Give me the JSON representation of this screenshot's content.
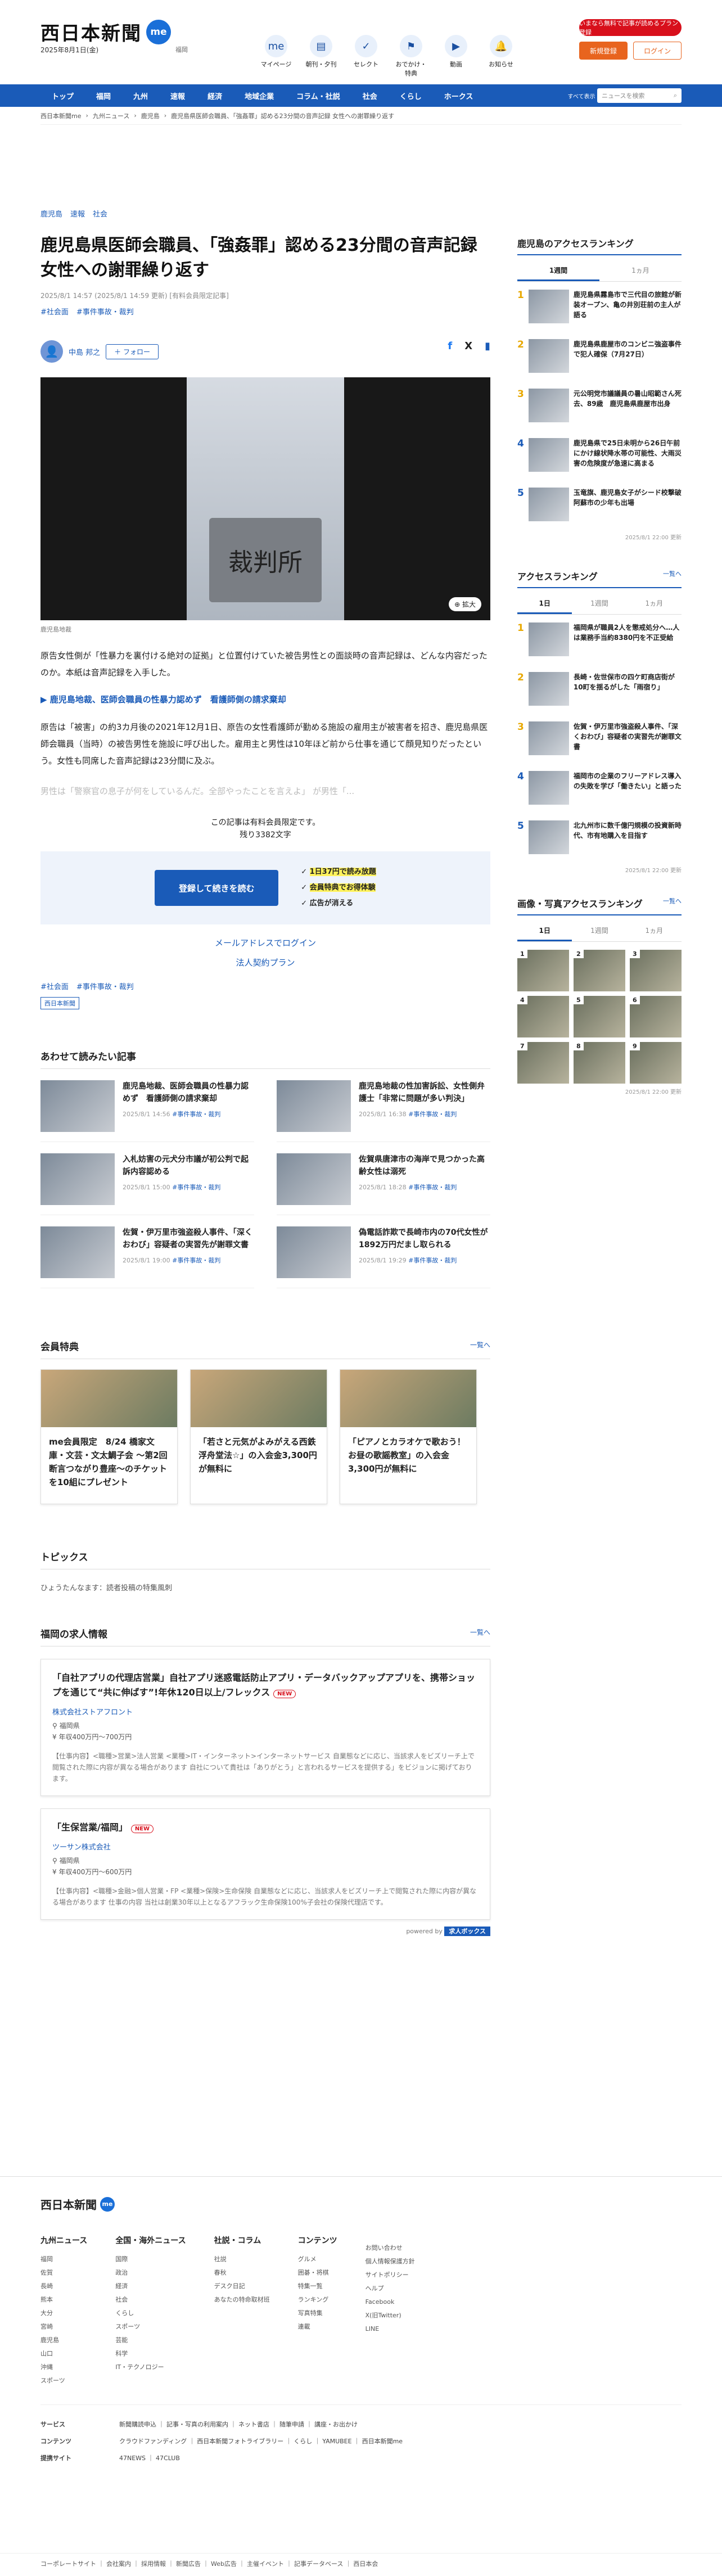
{
  "header": {
    "logo": "西日本新聞",
    "logo_me": "me",
    "date": "2025年8月1日(金)",
    "kyoku": "福岡",
    "icons": [
      {
        "label": "マイページ",
        "g": "me"
      },
      {
        "label": "朝刊・夕刊",
        "g": "▤"
      },
      {
        "label": "セレクト",
        "g": "✓"
      },
      {
        "label": "おでかけ・特典",
        "g": "⚑"
      },
      {
        "label": "動画",
        "g": "▶"
      },
      {
        "label": "お知らせ",
        "g": "🔔"
      }
    ],
    "register": "いまなら無料で記事が読めるプラン登録",
    "signup": "新規登録",
    "login": "ログイン"
  },
  "nav": {
    "items": [
      "トップ",
      "福岡",
      "九州",
      "速報",
      "経済",
      "地域企業",
      "コラム・社説",
      "社会",
      "くらし",
      "ホークス"
    ],
    "menu": "すべて表示",
    "search_placeholder": "ニュースを検索"
  },
  "breadcrumb": [
    "西日本新聞me",
    "九州ニュース",
    "鹿児島",
    "鹿児島県医師会職員、「強姦罪」認める23分間の音声記録 女性への謝罪繰り返す"
  ],
  "article": {
    "tags": [
      "鹿児島",
      "速報",
      "社会"
    ],
    "title": "鹿児島県医師会職員、「強姦罪」認める23分間の音声記録　女性への謝罪繰り返す",
    "meta": "2025/8/1 14:57 (2025/8/1 14:59 更新) [有料会員限定記事]",
    "hashtags": [
      "#社会面",
      "#事件事故・裁判"
    ],
    "author": "中島 邦之",
    "follow": "＋ フォロー",
    "photo_sign": "裁判所",
    "expand": "拡大",
    "caption": "鹿児島地裁",
    "p1": "原告女性側が「性暴力を裏付ける絶対の証拠」と位置付けていた被告男性との面談時の音声記録は、どんな内容だったのか。本紙は音声記録を入手した。",
    "link": "▶ 鹿児島地裁、医師会職員の性暴力認めず　看護師側の請求棄却",
    "p2": "原告は「被害」の約3カ月後の2021年12月1日、原告の女性看護師が勤める施設の雇用主が被害者を招き、鹿児島県医師会職員（当時）の被告男性を施設に呼び出した。雇用主と男性は10年ほど前から仕事を通じて顔見知りだったという。女性も同席した音声記録は23分間に及ぶ。",
    "p3": "男性は「警察官の息子が何をしているんだ。全部やったことを言えよ」 が男性「...",
    "paywall_line1": "この記事は有料会員限定です。",
    "paywall_line2": "残り3382文字",
    "cta": "登録して続きを読む",
    "benefits": [
      "1日37円で読み放題",
      "会員特典でお得体験",
      "広告が消える"
    ],
    "mail_login": "メールアドレスでログイン",
    "corp": "法人契約プラン",
    "bottom_tags": [
      "#社会面",
      "#事件事故・裁判"
    ],
    "source": "西日本新聞"
  },
  "related": {
    "title": "あわせて読みたい記事",
    "items": [
      {
        "t": "鹿児島地裁、医師会職員の性暴力認めず　看護師側の請求棄却",
        "d": "2025/8/1 14:56",
        "tag": "#事件事故・裁判"
      },
      {
        "t": "鹿児島地裁の性加害訴訟、女性側弁護士「非常に問題が多い判決」",
        "d": "2025/8/1 16:38",
        "tag": "#事件事故・裁判"
      },
      {
        "t": "入札妨害の元犬分市議が初公判で起訴内容認める",
        "d": "2025/8/1 15:00",
        "tag": "#事件事故・裁判"
      },
      {
        "t": "佐賀県唐津市の海岸で見つかった高齢女性は溺死",
        "d": "2025/8/1 18:28",
        "tag": "#事件事故・裁判"
      },
      {
        "t": "佐賀・伊万里市強盗殺人事件、「深くおわび」容疑者の実習先が謝罪文書",
        "d": "2025/8/1 19:00",
        "tag": "#事件事故・裁判"
      },
      {
        "t": "偽電話詐欺で長崎市内の70代女性が1892万円だまし取られる",
        "d": "2025/8/1 19:29",
        "tag": "#事件事故・裁判"
      }
    ]
  },
  "perks": {
    "title": "会員特典",
    "more": "一覧へ",
    "items": [
      "me会員限定　8/24 橋家文庫・文芸・文太鯛子会 〜第2回断言つながり豊座〜のチケットを10組にプレゼント",
      "「若さと元気がよみがえる西鉄浮舟堂法☆」の入会金3,300円が無料に",
      "「ピアノとカラオケで歌おう！　お昼の歌謡教室」の入会金3,300円が無料に"
    ]
  },
  "topics": {
    "title": "トピックス",
    "item": "ひょうたんなます：読者投稿の特集風刺"
  },
  "jobs": {
    "title": "福岡の求人情報",
    "more": "一覧へ",
    "items": [
      {
        "t": "「自社アプリの代理店営業」自社アプリ迷惑電話防止アプリ・データバックアップアプリを、携帯ショップを通じて“共に伸ばす”!年休120日以上/フレックス",
        "co": "株式会社ストアフロント",
        "loc": "福岡県",
        "sal": "年収400万円〜700万円",
        "d": "【仕事内容】<職種>営業>法人営業 <業種>IT・インターネット>インターネットサービス 自業態などに応じ、当該求人をビズリーチ上で閲覧された際に内容が異なる場合があります 自社について貴社は「ありがとう」と言われるサービスを提供する」をビジョンに掲げております。"
      },
      {
        "t": "「生保営業/福岡」",
        "co": "ツーサン株式会社",
        "loc": "福岡県",
        "sal": "年収400万円〜600万円",
        "d": "【仕事内容】<職種>金融>個人営業・FP <業種>保険>生命保険 自業態などに応じ、当該求人をビズリーチ上で閲覧された際に内容が異なる場合があります 仕事の内容 当社は創業30年以上となるアフラック生命保険100%子会社の保険代理店です。"
      }
    ],
    "powered": "powered by",
    "box": "求人ボックス"
  },
  "sidebar": {
    "rank1": {
      "title": "鹿児島のアクセスランキング",
      "tabs": [
        "1週間",
        "1ヵ月"
      ],
      "items": [
        "鹿児島県霧島市で三代目の旅館が新装オープン、亀の井別荘前の主人が語る",
        "鹿児島県鹿屋市のコンビニ強盗事件で犯人確保（7月27日）",
        "元公明党市議議員の暑山昭範さん死去、89歳　鹿児島県鹿屋市出身",
        "鹿児島県で25日未明から26日午前にかけ線状降水帯の可能性、大雨災害の危険度が急速に高まる",
        "玉竜旗、鹿児島女子がシード校撃破　阿蘇市の少年も出場"
      ],
      "updated": "2025/8/1 22:00 更新"
    },
    "rank2": {
      "title": "アクセスランキング",
      "more": "一覧へ",
      "tabs": [
        "1日",
        "1週間",
        "1ヵ月"
      ],
      "items": [
        "福岡県が職員2人を懲戒処分へ…人は業務手当約8380円を不正受給",
        "長崎・佐世保市の四ケ町商店街が10町を揺るがした「雨宿り」",
        "佐賀・伊万里市強盗殺人事件、「深くおわび」容疑者の実習先が謝罪文書",
        "福岡市の企業のフリーアドレス導入の失敗を学び「働きたい」と語った",
        "北九州市に数千億円規模の投資新時代、市有地購入を目指す"
      ],
      "updated": "2025/8/1 22:00 更新"
    },
    "photos": {
      "title": "画像・写真アクセスランキング",
      "more": "一覧へ",
      "tabs": [
        "1日",
        "1週間",
        "1ヵ月"
      ],
      "updated": "2025/8/1 22:00 更新"
    }
  },
  "footer": {
    "logo": "西日本新聞",
    "cols": [
      {
        "h": "九州ニュース",
        "items": [
          "福岡",
          "佐賀",
          "長崎",
          "熊本",
          "大分",
          "宮崎",
          "鹿児島",
          "山口",
          "沖縄",
          "スポーツ"
        ]
      },
      {
        "h": "全国・海外ニュース",
        "items": [
          "国際",
          "政治",
          "経済",
          "社会",
          "くらし",
          "スポーツ",
          "芸能",
          "科学",
          "IT・テクノロジー"
        ]
      },
      {
        "h": "社説・コラム",
        "items": [
          "社説",
          "春秋",
          "デスク日記",
          "あなたの特命取材班"
        ]
      },
      {
        "h": "コンテンツ",
        "items": [
          "グルメ",
          "囲碁・将棋",
          "特集一覧",
          "ランキング",
          "写真特集",
          "連載"
        ]
      },
      {
        "h": "",
        "items": [
          "お問い合わせ",
          "個人情報保護方針",
          "サイトポリシー",
          "ヘルプ",
          "Facebook",
          "X(旧Twitter)",
          "LINE"
        ]
      }
    ],
    "rows": [
      {
        "k": "サービス",
        "v": "新聞購読申込 ｜ 記事・写真の利用案内 ｜ ネット書店 ｜ 随筆申請 ｜ 講座・お出かけ"
      },
      {
        "k": "コンテンツ",
        "v": "クラウドファンディング ｜ 西日本新聞フォトライブラリー ｜ くらし ｜ YAMUBEE ｜ 西日本新聞me"
      },
      {
        "k": "提携サイト",
        "v": "47NEWS ｜ 47CLUB"
      }
    ],
    "copy": "コーポレートサイト ｜ 会社案内 ｜ 採用情報 ｜ 新聞広告 ｜ Web広告 ｜ 主催イベント ｜ 記事データベース ｜ 西日本会"
  }
}
